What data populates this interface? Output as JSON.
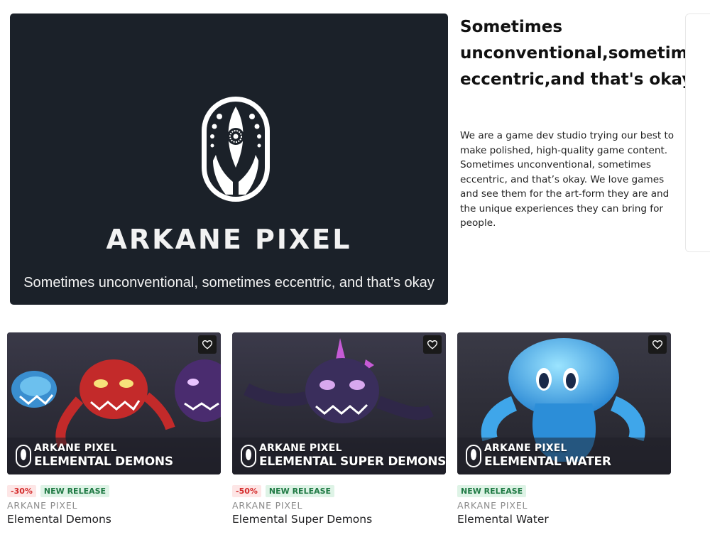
{
  "hero": {
    "brand": "ARKANE PIXEL",
    "tagline": "Sometimes unconventional, sometimes eccentric, and that's okay",
    "background": "#1b2129"
  },
  "about": {
    "title": "Sometimes unconventional,sometimes eccentric,and that's okay",
    "body": "We are a game dev studio trying our best to make polished, high-quality game content. Sometimes unconventional, sometimes eccentric, and that’s okay. We love games and see them for the art-form they are and the unique experiences they can bring for people."
  },
  "products": [
    {
      "thumb_brand": "ARKANE PIXEL",
      "thumb_product": "ELEMENTAL DEMONS",
      "discount": "-30%",
      "badge": "NEW RELEASE",
      "publisher": "ARKANE PIXEL",
      "title": "Elemental Demons",
      "icon": "heart-icon"
    },
    {
      "thumb_brand": "ARKANE PIXEL",
      "thumb_product": "ELEMENTAL SUPER DEMONS",
      "discount": "-50%",
      "badge": "NEW RELEASE",
      "publisher": "ARKANE PIXEL",
      "title": "Elemental Super Demons",
      "icon": "heart-icon"
    },
    {
      "thumb_brand": "ARKANE PIXEL",
      "thumb_product": "ELEMENTAL WATER",
      "discount": "",
      "badge": "NEW RELEASE",
      "publisher": "ARKANE PIXEL",
      "title": "Elemental Water",
      "icon": "heart-icon"
    }
  ],
  "colors": {
    "discount_text": "#d42b2b",
    "discount_bg": "#fde6e6",
    "new_text": "#1f7a44",
    "new_bg": "#def3e6"
  }
}
